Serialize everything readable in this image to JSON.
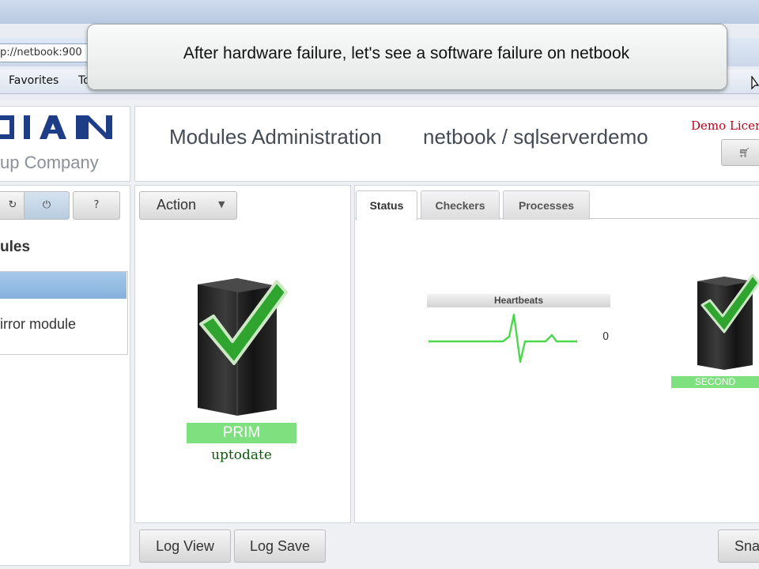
{
  "overlay": {
    "caption": "After hardware failure, let's see a software failure on netbook"
  },
  "browser": {
    "address": "p://netbook:900",
    "menu": [
      "Favorites",
      "To"
    ]
  },
  "header": {
    "logo_wordmark": "DIAN",
    "logo_subtitle": "up Company",
    "title": "Modules Administration",
    "context": "netbook / sqlserverdemo",
    "license_text": "Demo Licen"
  },
  "toolbar": {
    "refresh_icon": "↻",
    "power_icon": "⏻",
    "help_label": "?"
  },
  "modules": {
    "heading": "ules",
    "items": [
      "",
      "irror module"
    ]
  },
  "actions": {
    "action_label": "Action"
  },
  "primary": {
    "label": "PRIM",
    "status": "uptodate"
  },
  "tabs": [
    "Status",
    "Checkers",
    "Processes"
  ],
  "heartbeats": {
    "title": "Heartbeats",
    "count": "0"
  },
  "secondary": {
    "label": "SECOND"
  },
  "footer": {
    "log_view": "Log View",
    "log_save": "Log Save",
    "snap": "Snap"
  },
  "colors": {
    "ok_green": "#7fe07f",
    "license_red": "#c0001a",
    "selection_blue": "#86b1dd"
  }
}
